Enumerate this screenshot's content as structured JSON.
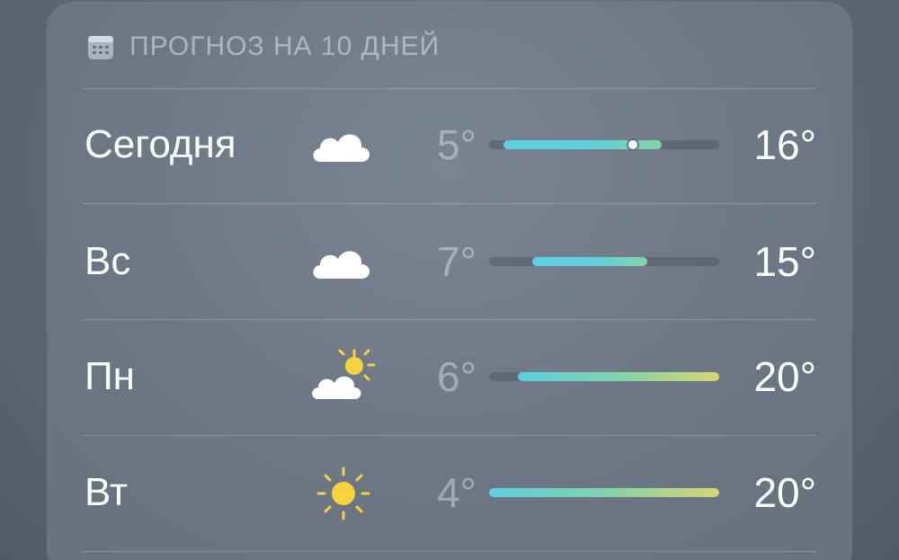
{
  "forecast": {
    "title": "ПРОГНОЗ НА 10 ДНЕЙ",
    "title_icon": "calendar-icon",
    "range_min": 4,
    "range_max": 20,
    "current_temp": 14,
    "days": [
      {
        "day": "Сегодня",
        "icon": "cloud-icon",
        "low": "5°",
        "high": "16°",
        "low_val": 5,
        "high_val": 16
      },
      {
        "day": "Вс",
        "icon": "cloud-icon",
        "low": "7°",
        "high": "15°",
        "low_val": 7,
        "high_val": 15
      },
      {
        "day": "Пн",
        "icon": "partly-sunny-icon",
        "low": "6°",
        "high": "20°",
        "low_val": 6,
        "high_val": 20
      },
      {
        "day": "Вт",
        "icon": "sun-icon",
        "low": "4°",
        "high": "20°",
        "low_val": 4,
        "high_val": 20
      }
    ]
  },
  "colors": {
    "cool": "#5ccfe0",
    "mild": "#7fd4a8",
    "warm": "#d8d470"
  }
}
